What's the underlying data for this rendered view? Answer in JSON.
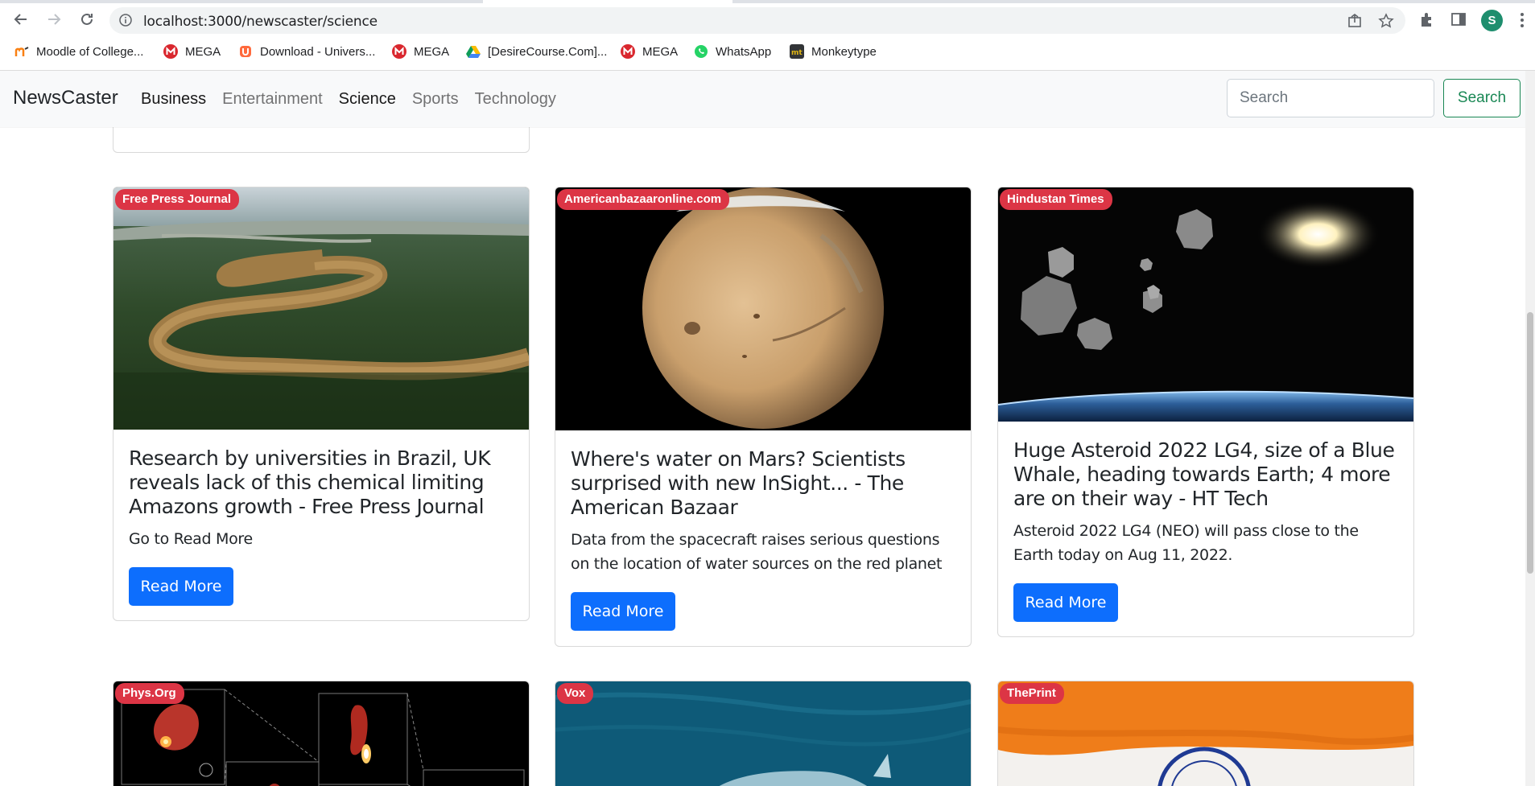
{
  "browser": {
    "url": "localhost:3000/newscaster/science",
    "profile_initial": "S",
    "bookmarks": [
      {
        "label": "Moodle of College...",
        "icon": "moodle-icon"
      },
      {
        "label": "MEGA",
        "icon": "mega-icon"
      },
      {
        "label": "Download - Univers...",
        "icon": "uniconverter-icon"
      },
      {
        "label": "MEGA",
        "icon": "mega-icon"
      },
      {
        "label": "[DesireCourse.Com]...",
        "icon": "google-drive-icon"
      },
      {
        "label": "MEGA",
        "icon": "mega-icon"
      },
      {
        "label": "WhatsApp",
        "icon": "whatsapp-icon"
      },
      {
        "label": "Monkeytype",
        "icon": "monkeytype-icon"
      }
    ]
  },
  "navbar": {
    "brand": "NewsCaster",
    "links": [
      {
        "label": "Business",
        "active": true
      },
      {
        "label": "Entertainment",
        "active": false
      },
      {
        "label": "Science",
        "active": true
      },
      {
        "label": "Sports",
        "active": false
      },
      {
        "label": "Technology",
        "active": false
      }
    ],
    "search_placeholder": "Search",
    "search_button": "Search"
  },
  "cards": [
    {
      "source": "Free Press Journal",
      "title": "Research by universities in Brazil, UK reveals lack of this chemical limiting Amazons growth - Free Press Journal",
      "description": "Go to Read More",
      "button": "Read More",
      "image": "amazon-river-image"
    },
    {
      "source": "Americanbazaaronline.com",
      "title": "Where's water on Mars? Scientists surprised with new InSight... - The American Bazaar",
      "description": "Data from the spacecraft raises serious questions on the location of water sources on the red planet",
      "button": "Read More",
      "image": "mars-planet-image"
    },
    {
      "source": "Hindustan Times",
      "title": "Huge Asteroid 2022 LG4, size of a Blue Whale, heading towards Earth; 4 more are on their way - HT Tech",
      "description": "Asteroid 2022 LG4 (NEO) will pass close to the Earth today on Aug 11, 2022.",
      "button": "Read More",
      "image": "asteroids-earth-image"
    }
  ],
  "partial_cards": [
    {
      "source": "Phys.Org",
      "image": "black-hole-telescope-image"
    },
    {
      "source": "Vox",
      "image": "whale-ocean-image"
    },
    {
      "source": "ThePrint",
      "image": "india-flag-image"
    }
  ],
  "colors": {
    "badge": "#dc3545",
    "primary_button": "#0d6efd",
    "search_outline": "#198754",
    "navbar_bg": "#f8f9fa"
  }
}
